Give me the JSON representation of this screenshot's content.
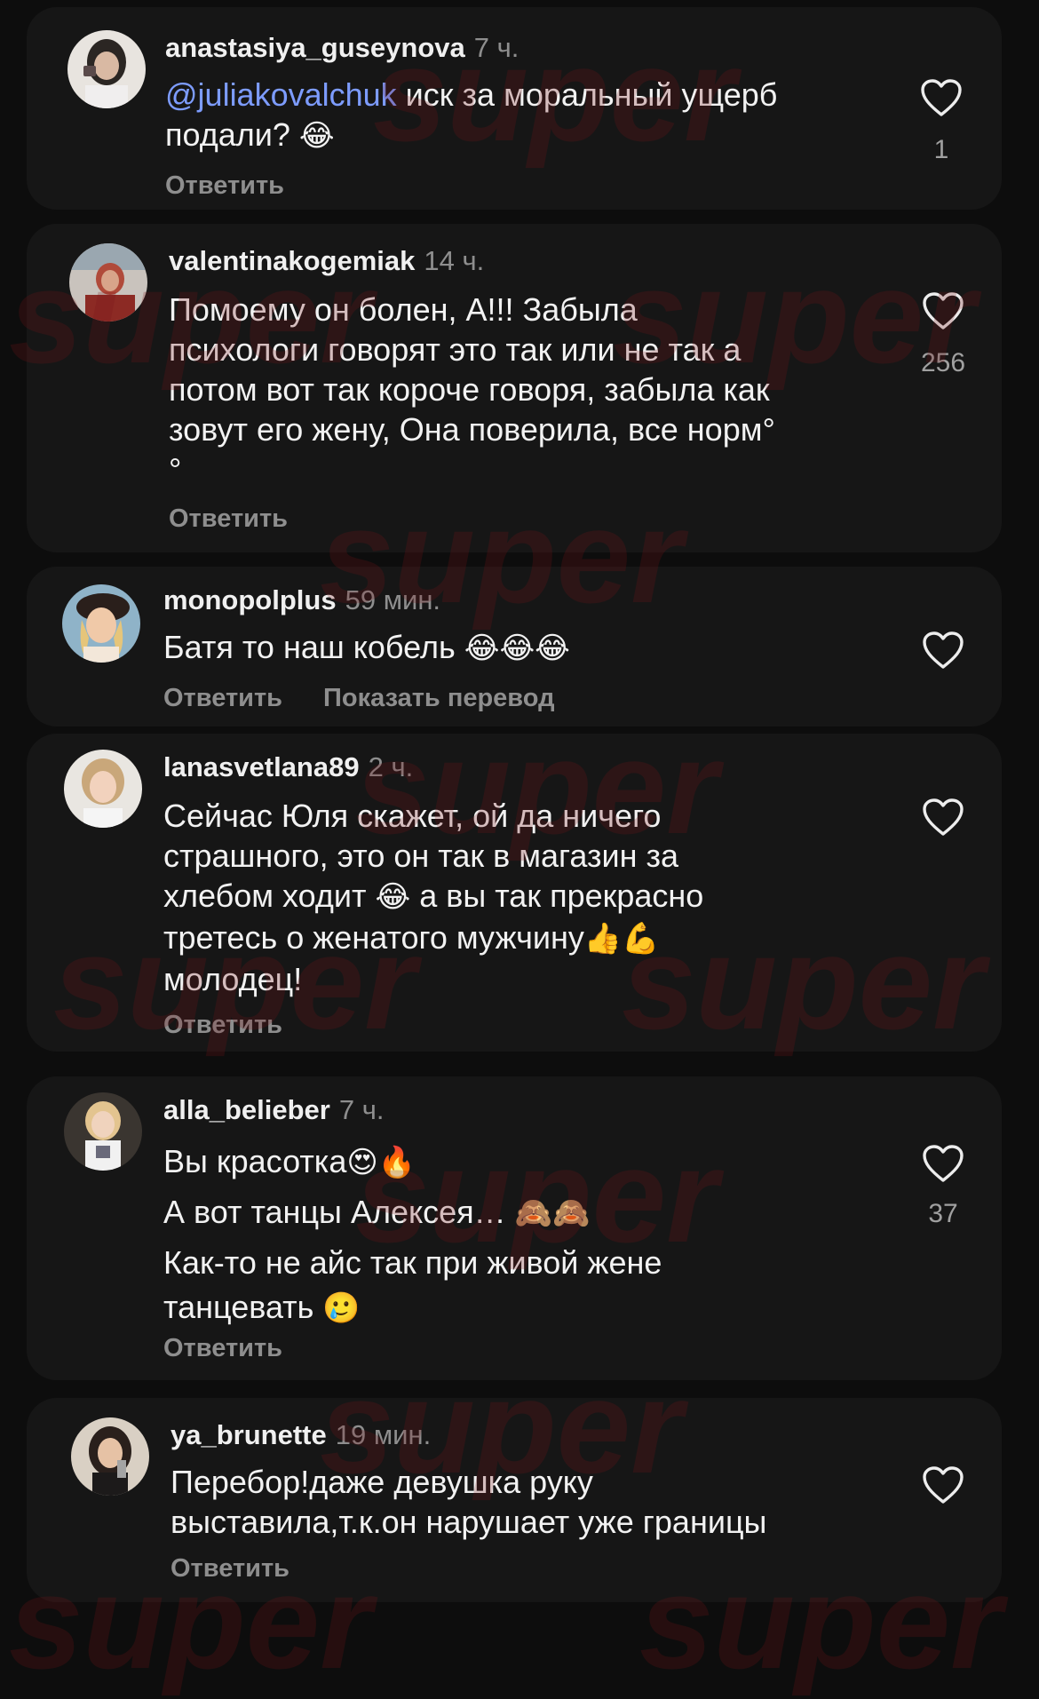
{
  "watermark": "super",
  "colors": {
    "background": "#0d0d0d",
    "card": "#161616",
    "mention": "#7d9cff",
    "muted": "#8e8e8e",
    "watermark": "#781419"
  },
  "icons": {
    "like": "heart-outline-icon"
  },
  "comments": [
    {
      "username": "anastasiya_guseynova",
      "time": "7 ч.",
      "mention": "@juliakovalchuk",
      "text_lines": [
        " иск за моральный ущерб",
        "подали? "
      ],
      "emojis": [
        "😂"
      ],
      "reply": "Ответить",
      "likes": "1"
    },
    {
      "username": "valentinakogemiak",
      "time": "14 ч.",
      "text_lines": [
        "Помоему он болен, А!!! Забыла",
        "психологи говорят это так или не так а",
        "потом вот так короче говоря, забыла как",
        "зовут его жену, Она поверила, все норм°",
        "°"
      ],
      "reply": "Ответить",
      "likes": "256"
    },
    {
      "username": "monopolplus",
      "time": "59 мин.",
      "text_lines": [
        "Батя то наш кобель "
      ],
      "emojis": [
        "😂😂😂"
      ],
      "reply": "Ответить",
      "translate": "Показать перевод"
    },
    {
      "username": "lanasvetlana89",
      "time": "2 ч.",
      "text_lines": [
        "Сейчас Юля скажет, ой да ничего",
        "страшного, это он так в магазин за",
        "хлебом ходит ",
        " а вы так прекрасно",
        "третесь о женатого мужчину",
        "молодец!"
      ],
      "emojis": [
        "😂",
        "👍💪"
      ],
      "reply": "Ответить"
    },
    {
      "username": "alla_belieber",
      "time": "7 ч.",
      "text_lines": [
        "Вы красотка",
        "А вот танцы Алексея… ",
        "Как-то не айс так при живой жене",
        "танцевать "
      ],
      "emojis": [
        "😍🔥",
        "🙈🙈",
        "🥲"
      ],
      "reply": "Ответить",
      "likes": "37"
    },
    {
      "username": "ya_brunette",
      "time": "19 мин.",
      "text_lines": [
        "Перебор!даже девушка руку",
        "выставила,т.к.он нарушает уже границы"
      ],
      "reply": "Ответить"
    }
  ]
}
